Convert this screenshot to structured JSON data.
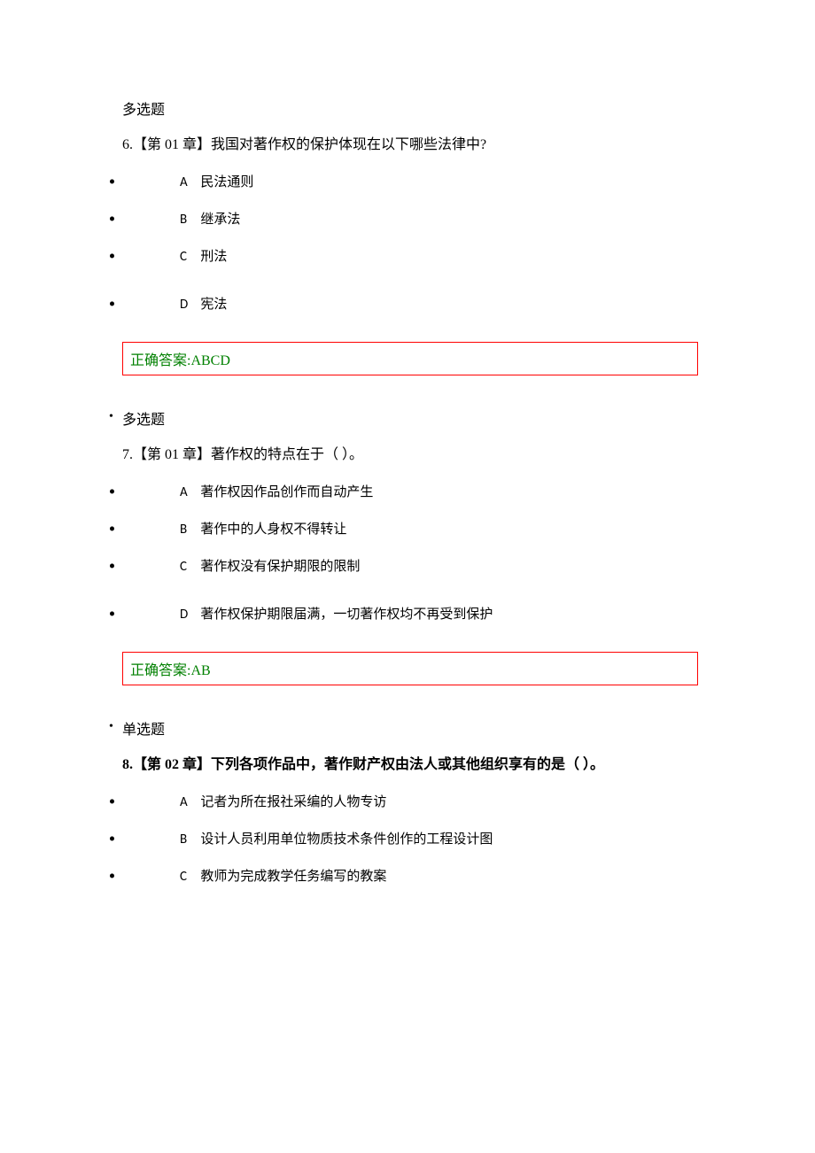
{
  "questions": [
    {
      "type": "多选题",
      "number": "6.",
      "chapter": "【第 01 章】",
      "text": "我国对著作权的保护体现在以下哪些法律中?",
      "bold": false,
      "options": [
        {
          "letter": "A",
          "text": "民法通则",
          "spaced": false
        },
        {
          "letter": "B",
          "text": "继承法",
          "spaced": false
        },
        {
          "letter": "C",
          "text": "刑法",
          "spaced": false
        },
        {
          "letter": "D",
          "text": "宪法",
          "spaced": true
        }
      ],
      "answer_label": "正确答案:",
      "answer": "ABCD"
    },
    {
      "type": "多选题",
      "number": "7.",
      "chapter": "【第 01 章】",
      "text": "著作权的特点在于（ ）。",
      "bold": false,
      "options": [
        {
          "letter": "A",
          "text": "著作权因作品创作而自动产生",
          "spaced": false
        },
        {
          "letter": "B",
          "text": "著作中的人身权不得转让",
          "spaced": false
        },
        {
          "letter": "C",
          "text": "著作权没有保护期限的限制",
          "spaced": false
        },
        {
          "letter": "D",
          "text": "著作权保护期限届满，一切著作权均不再受到保护",
          "spaced": true
        }
      ],
      "answer_label": "正确答案:",
      "answer": "AB"
    },
    {
      "type": "单选题",
      "number": "8.",
      "chapter": "【第 02 章】",
      "text": "下列各项作品中，著作财产权由法人或其他组织享有的是（ ）。",
      "bold": true,
      "options": [
        {
          "letter": "A",
          "text": "记者为所在报社采编的人物专访",
          "spaced": false
        },
        {
          "letter": "B",
          "text": "设计人员利用单位物质技术条件创作的工程设计图",
          "spaced": false
        },
        {
          "letter": "C",
          "text": "教师为完成教学任务编写的教案",
          "spaced": false
        }
      ],
      "answer_label": "",
      "answer": ""
    }
  ]
}
